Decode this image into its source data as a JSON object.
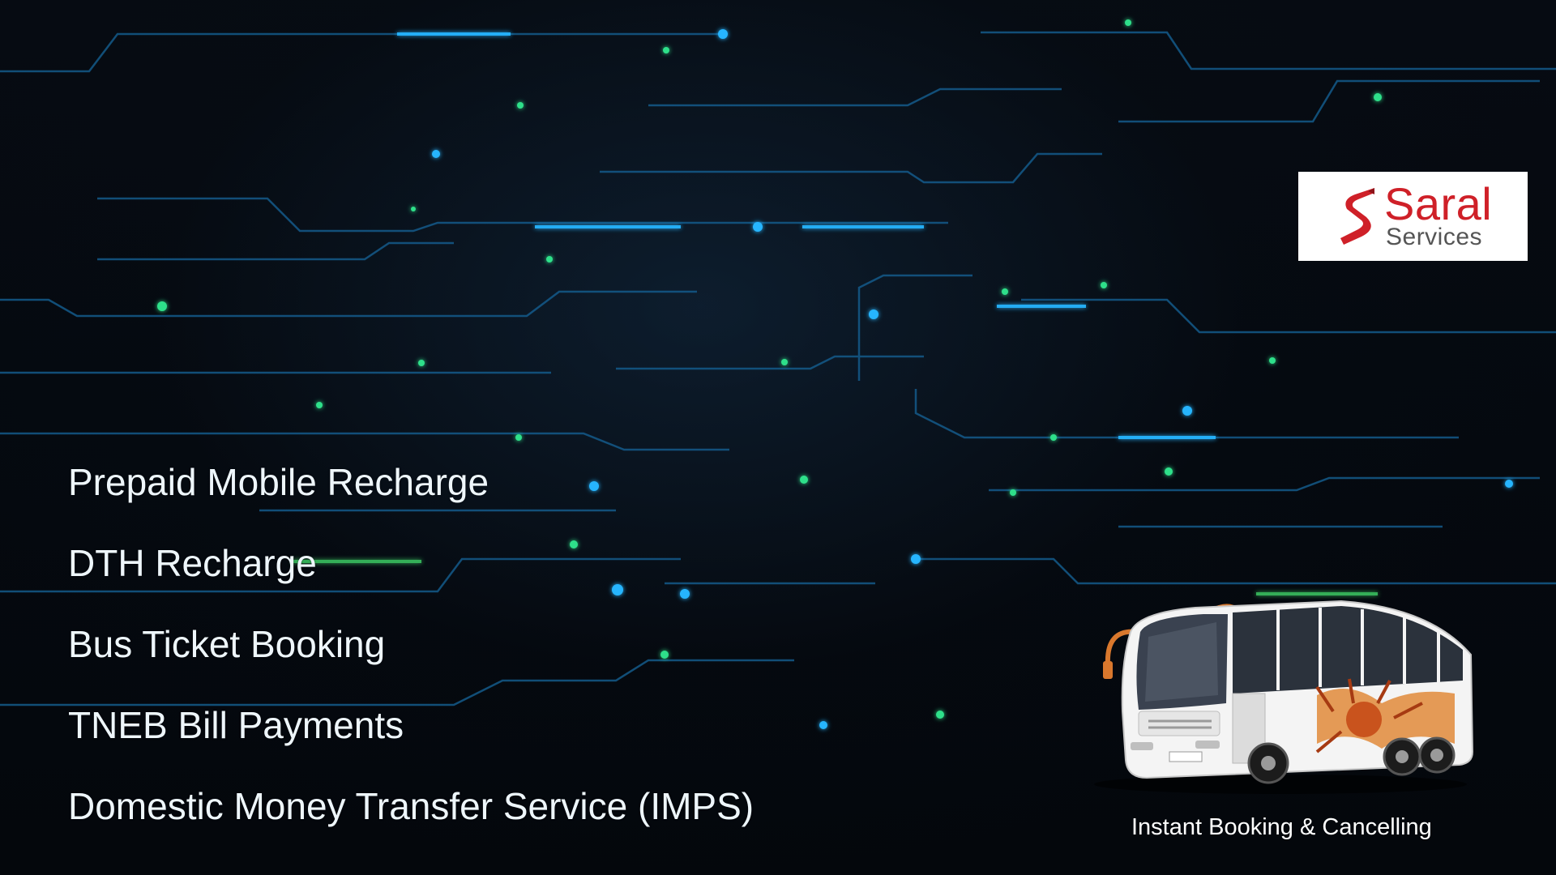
{
  "brand": {
    "name": "Saral",
    "tagline": "Services",
    "accent_color": "#cf2028"
  },
  "services": [
    "Prepaid Mobile Recharge",
    "DTH Recharge",
    "Bus Ticket Booking",
    "TNEB Bill Payments",
    "Domestic Money Transfer Service (IMPS)"
  ],
  "bus_caption": "Instant Booking & Cancelling",
  "colors": {
    "background": "#04080d",
    "circuit_line": "#1a6fa8",
    "circuit_glow": "#27b5ff",
    "dot_green": "#2fe08a",
    "text": "#eef6fb"
  }
}
